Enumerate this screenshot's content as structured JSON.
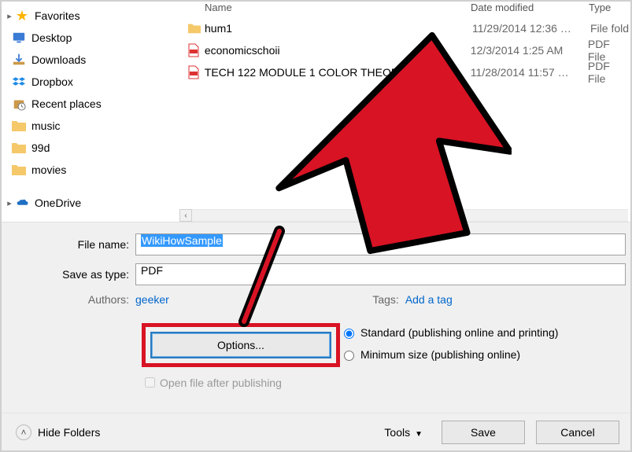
{
  "columns": {
    "name": "Name",
    "date": "Date modified",
    "type": "Type"
  },
  "sidebar": {
    "favorites": "Favorites",
    "items": [
      {
        "label": "Desktop"
      },
      {
        "label": "Downloads"
      },
      {
        "label": "Dropbox"
      },
      {
        "label": "Recent places"
      },
      {
        "label": "music"
      },
      {
        "label": "99d"
      },
      {
        "label": "movies"
      }
    ],
    "onedrive": "OneDrive"
  },
  "files": [
    {
      "name": "hum1",
      "date": "11/29/2014 12:36 …",
      "type": "File fold",
      "kind": "folder"
    },
    {
      "name": "economicschoii",
      "date": "12/3/2014 1:25 AM",
      "type": "PDF File",
      "kind": "pdf"
    },
    {
      "name": "TECH 122 MODULE 1 COLOR THEORIES(2)",
      "date": "11/28/2014 11:57 …",
      "type": "PDF File",
      "kind": "pdf"
    }
  ],
  "form": {
    "filename_label": "File name:",
    "filename_value": "WikiHowSample",
    "saveastype_label": "Save as type:",
    "saveastype_value": "PDF",
    "authors_label": "Authors:",
    "authors_value": "geeker",
    "tags_label": "Tags:",
    "tags_value": "Add a tag",
    "options_label": "Options...",
    "openfile_label": "Open file after publishing",
    "radio_standard": "Standard (publishing online and printing)",
    "radio_minimum": "Minimum size (publishing online)"
  },
  "bottom": {
    "hide_folders": "Hide Folders",
    "tools": "Tools",
    "save": "Save",
    "cancel": "Cancel"
  }
}
